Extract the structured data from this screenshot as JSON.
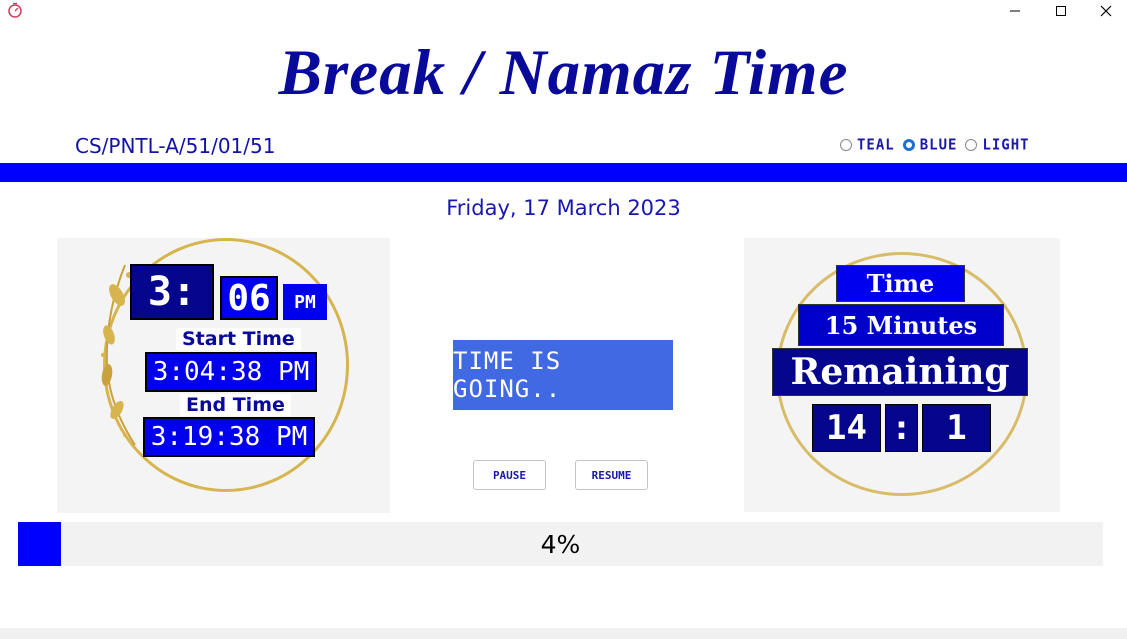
{
  "window": {
    "app_icon": "stopwatch-icon",
    "controls": [
      "minimize-icon",
      "maximize-icon",
      "close-icon"
    ]
  },
  "header": {
    "title": "Break / Namaz Time",
    "code": "CS/PNTL-A/51/01/51"
  },
  "themes": {
    "options": [
      "TEAL",
      "BLUE",
      "LIGHT"
    ],
    "selected": "BLUE"
  },
  "date": "Friday, 17 March 2023",
  "clock": {
    "hour": "3",
    "separator": ":",
    "minute": "06",
    "ampm": "PM",
    "start_label": "Start Time",
    "start_value": "3:04:38 PM",
    "end_label": "End Time",
    "end_value": "3:19:38 PM"
  },
  "status": {
    "message": "TIME IS GOING..",
    "pause_label": "PAUSE",
    "resume_label": "RESUME"
  },
  "remaining": {
    "line1": "Time",
    "line2": "15 Minutes",
    "line3": "Remaining",
    "minutes": "14",
    "separator": ":",
    "seconds": "1"
  },
  "progress": {
    "percent": 4,
    "label": "4%"
  },
  "colors": {
    "accent": "#0000ff",
    "title": "#0a0a9a",
    "status_bg": "#4169e1",
    "gold": "#d6b44e"
  }
}
